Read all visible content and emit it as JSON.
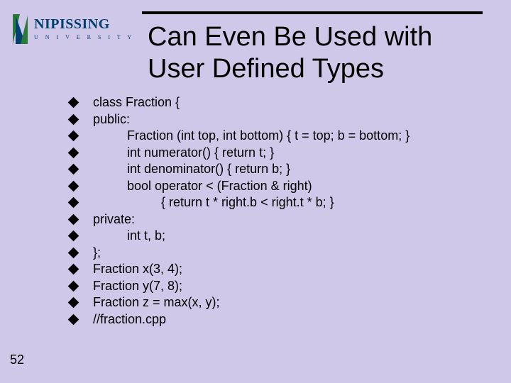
{
  "logo": {
    "name": "NIPISSING",
    "sub": "U N I V E R S I T Y"
  },
  "title": "Can Even Be Used with User Defined Types",
  "codeLines": [
    {
      "text": "class Fraction {",
      "indent": 0
    },
    {
      "text": "public:",
      "indent": 0
    },
    {
      "text": "Fraction (int top, int bottom) { t = top; b = bottom; }",
      "indent": 1
    },
    {
      "text": "int numerator() { return t; }",
      "indent": 1
    },
    {
      "text": "int denominator() { return b; }",
      "indent": 1
    },
    {
      "text": "bool operator < (Fraction & right)",
      "indent": 1
    },
    {
      "text": "{ return t * right.b < right.t * b; }",
      "indent": 2
    },
    {
      "text": "private:",
      "indent": 0
    },
    {
      "text": "int t, b;",
      "indent": 1
    },
    {
      "text": "};",
      "indent": 0
    },
    {
      "text": "Fraction x(3, 4);",
      "indent": 0
    },
    {
      "text": "Fraction y(7, 8);",
      "indent": 0
    },
    {
      "text": "Fraction z = max(x, y);",
      "indent": 0
    },
    {
      "text": "//fraction.cpp",
      "indent": 0
    }
  ],
  "pageNumber": "52"
}
